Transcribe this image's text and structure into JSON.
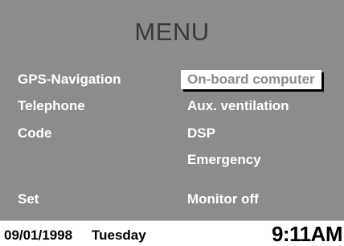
{
  "menu": {
    "title": "MENU",
    "left_items": [
      {
        "label": "GPS-Navigation"
      },
      {
        "label": "Telephone"
      },
      {
        "label": "Code"
      },
      {
        "label": "Set"
      }
    ],
    "right_items": [
      {
        "label": "On-board computer",
        "selected": true
      },
      {
        "label": "Aux. ventilation",
        "selected": false
      },
      {
        "label": "DSP",
        "selected": false
      },
      {
        "label": "Emergency",
        "selected": false
      },
      {
        "label": "Monitor off",
        "selected": false
      }
    ]
  },
  "status": {
    "date": "09/01/1998",
    "day": "Tuesday",
    "time": "9:11AM"
  },
  "colors": {
    "background": "#8c8c8c",
    "title": "#3a3a3a",
    "item_text": "#ffffff",
    "selected_bg": "#ffffff",
    "statusbar_bg": "#ffffff"
  }
}
